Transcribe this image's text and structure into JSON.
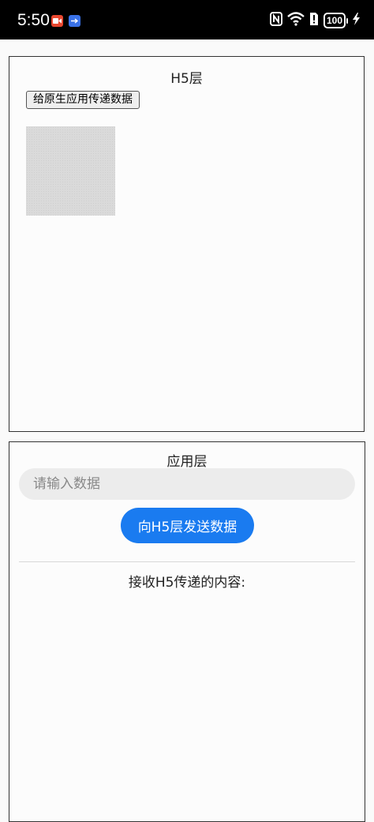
{
  "status_bar": {
    "time": "5:50",
    "battery": "100",
    "icons": [
      "screen-record-icon",
      "usb-icon",
      "nfc-icon",
      "wifi-icon",
      "sim-alert-icon",
      "battery-icon",
      "charging-icon"
    ]
  },
  "h5_layer": {
    "title": "H5层",
    "send_to_native_label": "给原生应用传递数据"
  },
  "app_layer": {
    "title": "应用层",
    "input_value": "",
    "input_placeholder": "请输入数据",
    "send_button_label": "向H5层发送数据",
    "receive_label": "接收H5传递的内容:"
  },
  "colors": {
    "accent": "#1a7bf0",
    "status_bar_bg": "#000000",
    "record_icon": "#e8472f",
    "usb_icon": "#3a72e8"
  }
}
